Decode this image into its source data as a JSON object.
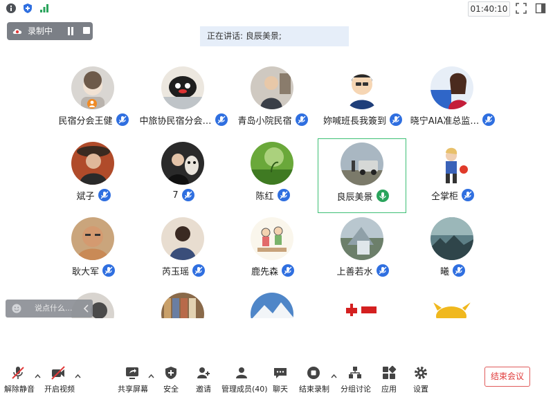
{
  "topbar": {
    "time": "01:40:10"
  },
  "recording": {
    "label": "录制中"
  },
  "speaking": {
    "text": "正在讲话: 良辰美景;"
  },
  "participants": [
    {
      "name": "民宿分会王健",
      "mic": "muted",
      "host": true
    },
    {
      "name": "中旅协民宿分会…",
      "mic": "muted"
    },
    {
      "name": "青岛小院民宿",
      "mic": "muted"
    },
    {
      "name": "妳喊班長我簽到",
      "mic": "muted"
    },
    {
      "name": "晓宁AIA准总监…",
      "mic": "muted"
    },
    {
      "name": "斌子",
      "mic": "muted"
    },
    {
      "name": "7",
      "mic": "muted"
    },
    {
      "name": "陈红",
      "mic": "muted"
    },
    {
      "name": "良辰美景",
      "mic": "speaking",
      "active": true
    },
    {
      "name": "仝掌柜",
      "mic": "muted"
    },
    {
      "name": "耿大军",
      "mic": "muted"
    },
    {
      "name": "芮玉瑶",
      "mic": "muted"
    },
    {
      "name": "鹿先森",
      "mic": "muted"
    },
    {
      "name": "上善若水",
      "mic": "muted"
    },
    {
      "name": "曦",
      "mic": "muted"
    }
  ],
  "chat": {
    "placeholder": "说点什么..."
  },
  "toolbar": {
    "unmute": "解除静音",
    "video": "开启视频",
    "share": "共享屏幕",
    "security": "安全",
    "invite": "邀请",
    "members": "管理成员(40)",
    "chat": "聊天",
    "end_record": "结束录制",
    "breakout": "分组讨论",
    "apps": "应用",
    "settings": "设置",
    "end_meeting": "结束会议"
  },
  "colors": {
    "accent": "#2f6fe0",
    "active_border": "#3cbf74",
    "speaking_mic": "#2aa45c",
    "end": "#e03a3a"
  }
}
